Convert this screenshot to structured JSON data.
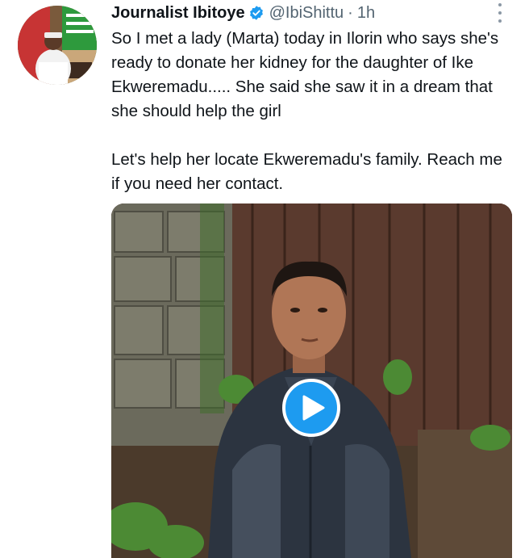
{
  "tweet": {
    "author": {
      "display_name": "Journalist Ibitoye",
      "handle": "@IbiShittu",
      "separator": "·",
      "time": "1h",
      "verified": true
    },
    "text": {
      "paragraph_1": "So I met a lady (Marta) today in Ilorin who says she's ready to donate her kidney for the daughter of Ike Ekweremadu..... She said she saw it in a dream that she should help the girl",
      "paragraph_2": "Let's help her locate Ekweremadu's family. Reach me if you need her contact."
    },
    "media": {
      "type": "video",
      "play_icon": "play-icon"
    },
    "colors": {
      "accent": "#1d9bf0",
      "text": "#0f1419",
      "secondary_text": "#536471"
    },
    "icons": {
      "verified": "verified-badge-icon",
      "more": "more-options-icon"
    }
  }
}
